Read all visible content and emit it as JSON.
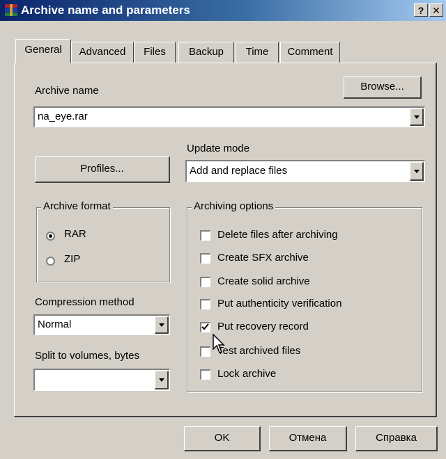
{
  "window": {
    "title": "Archive name and parameters",
    "help_label": "?",
    "close_label": "✕"
  },
  "tabs": [
    {
      "label": "General",
      "active": true
    },
    {
      "label": "Advanced",
      "active": false
    },
    {
      "label": "Files",
      "active": false
    },
    {
      "label": "Backup",
      "active": false
    },
    {
      "label": "Time",
      "active": false
    },
    {
      "label": "Comment",
      "active": false
    }
  ],
  "archive": {
    "name_label": "Archive name",
    "name_value": "na_eye.rar",
    "browse_label": "Browse..."
  },
  "profiles_label": "Profiles...",
  "update_mode": {
    "label": "Update mode",
    "value": "Add and replace files"
  },
  "archive_format": {
    "title": "Archive format",
    "options": [
      {
        "label": "RAR",
        "selected": true
      },
      {
        "label": "ZIP",
        "selected": false
      }
    ]
  },
  "compression": {
    "label": "Compression method",
    "value": "Normal"
  },
  "split": {
    "label": "Split to volumes, bytes",
    "value": ""
  },
  "archiving_options": {
    "title": "Archiving options",
    "items": [
      {
        "label": "Delete files after archiving",
        "checked": false
      },
      {
        "label": "Create SFX archive",
        "checked": false
      },
      {
        "label": "Create solid archive",
        "checked": false
      },
      {
        "label": "Put authenticity verification",
        "checked": false
      },
      {
        "label": "Put recovery record",
        "checked": true
      },
      {
        "label": "Test archived files",
        "checked": false
      },
      {
        "label": "Lock archive",
        "checked": false
      }
    ]
  },
  "footer": {
    "ok_label": "OK",
    "cancel_label": "Отмена",
    "help_label": "Справка"
  }
}
